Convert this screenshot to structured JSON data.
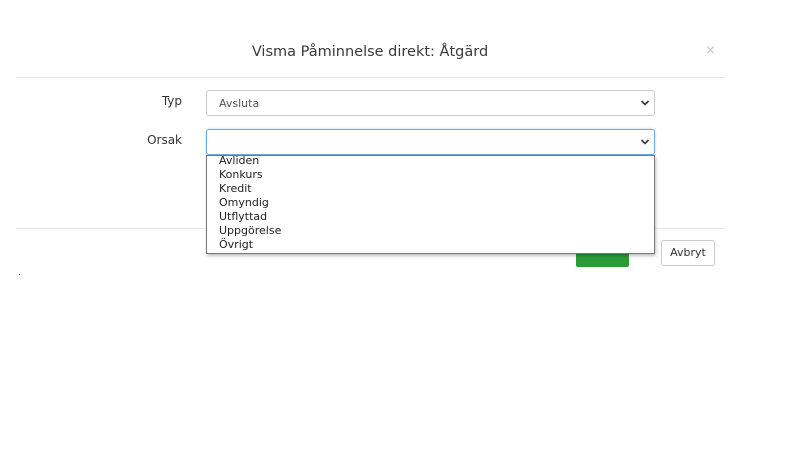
{
  "dialog": {
    "title": "Visma Påminnelse direkt: Åtgärd",
    "close_symbol": "×"
  },
  "form": {
    "type_label": "Typ",
    "type_value": "Avsluta",
    "reason_label": "Orsak",
    "reason_value": ""
  },
  "dropdown": {
    "options": [
      "Avliden",
      "Konkurs",
      "Kredit",
      "Omyndig",
      "Utflyttad",
      "Uppgörelse",
      "Övrigt"
    ]
  },
  "footer": {
    "ok_label": "",
    "cancel_label": "Avbryt"
  },
  "colors": {
    "primary": "#2c9a38",
    "focus_border": "#66afe9"
  },
  "icons": [
    "close-icon",
    "chevron-down-icon"
  ]
}
